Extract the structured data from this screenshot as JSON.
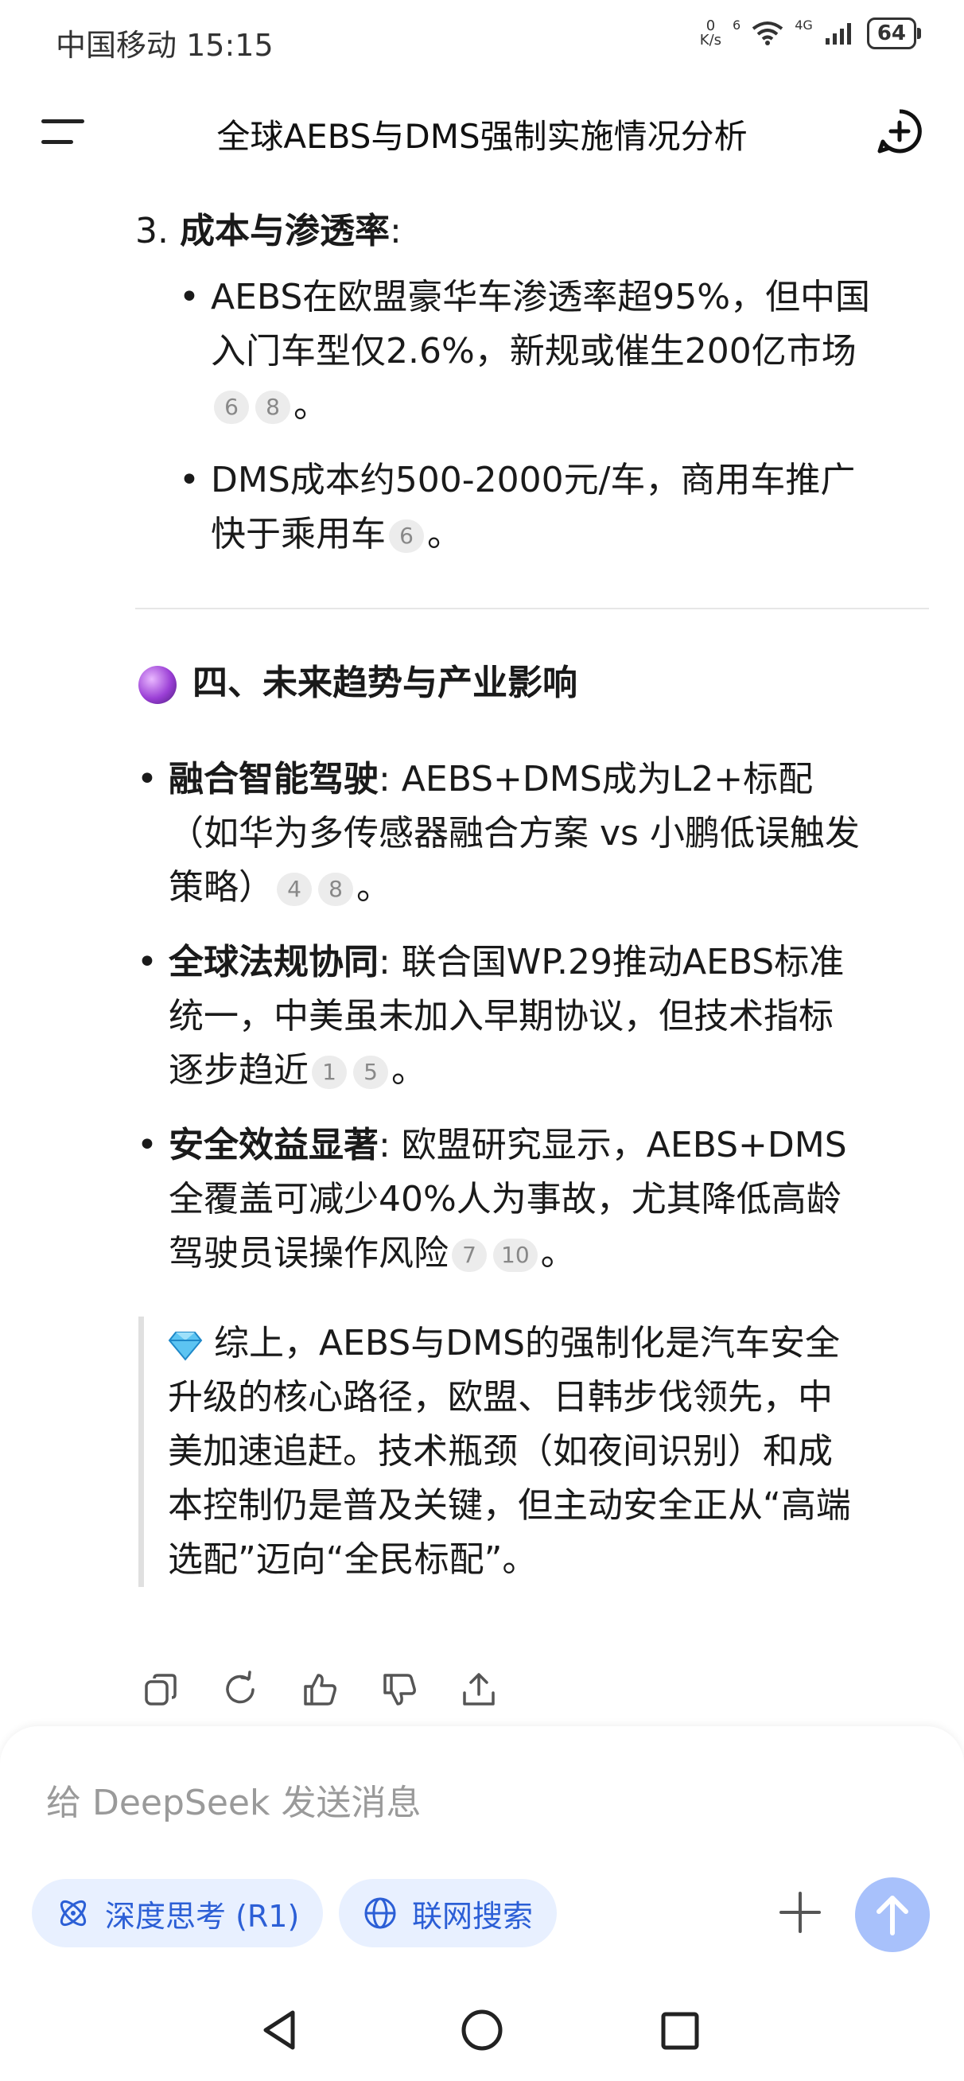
{
  "status_bar": {
    "carrier": "中国移动",
    "time": "15:15",
    "net_speed_value": "0",
    "net_speed_unit": "K/s",
    "wifi_badge": "6",
    "network_type": "4G",
    "battery": "64"
  },
  "header": {
    "title": "全球AEBS与DMS强制实施情况分析"
  },
  "content": {
    "numbered_item": {
      "number": "3.",
      "title": "成本与渗透率",
      "suffix": ":"
    },
    "cost_bullets": [
      {
        "line1": "AEBS在欧盟豪华车渗透率超95%，但中国",
        "line2": "入门车型仅2.6%，新规或催生200亿市场",
        "cites": [
          "6",
          "8"
        ],
        "end": "。"
      },
      {
        "line1": "DMS成本约500-2000元/车，商用车推广",
        "line2": "快于乘用车",
        "cites": [
          "6"
        ],
        "end": "。"
      }
    ],
    "section4_title": "四、未来趋势与产业影响",
    "trend_bullets": [
      {
        "bold": "融合智能驾驶",
        "line1": ": AEBS+DMS成为L2+标配",
        "line2": "（如华为多传感器融合方案 vs 小鹏低误触发",
        "line3": "策略）",
        "cites": [
          "4",
          "8"
        ],
        "end": "。"
      },
      {
        "bold": "全球法规协同",
        "line1": ": 联合国WP.29推动AEBS标准",
        "line2": "统一，中美虽未加入早期协议，但技术指标",
        "line3": "逐步趋近",
        "cites": [
          "1",
          "5"
        ],
        "end": "。"
      },
      {
        "bold": "安全效益显著",
        "line1": ": 欧盟研究显示，AEBS+DMS",
        "line2": "全覆盖可减少40%人为事故，尤其降低高龄",
        "line3": "驾驶员误操作风险",
        "cites": [
          "7",
          "10"
        ],
        "end": "。"
      }
    ],
    "summary": {
      "line1": "综上，AEBS与DMS的强制化是汽车安全",
      "line2": "升级的核心路径，欧盟、日韩步伐领先，中",
      "line3": "美加速追赶。技术瓶颈（如夜间识别）和成",
      "line4": "本控制仍是普及关键，但主动安全正从“高端",
      "line5": "选配”迈向“全民标配”。"
    }
  },
  "composer": {
    "placeholder": "给 DeepSeek 发送消息",
    "deep_think_label": "深度思考 (R1)",
    "web_search_label": "联网搜索"
  },
  "colors": {
    "accent": "#2c5fd6",
    "chip_bg": "#e8f0ff",
    "send_bg": "#a8c1fb",
    "cite_bg": "#ececec"
  }
}
